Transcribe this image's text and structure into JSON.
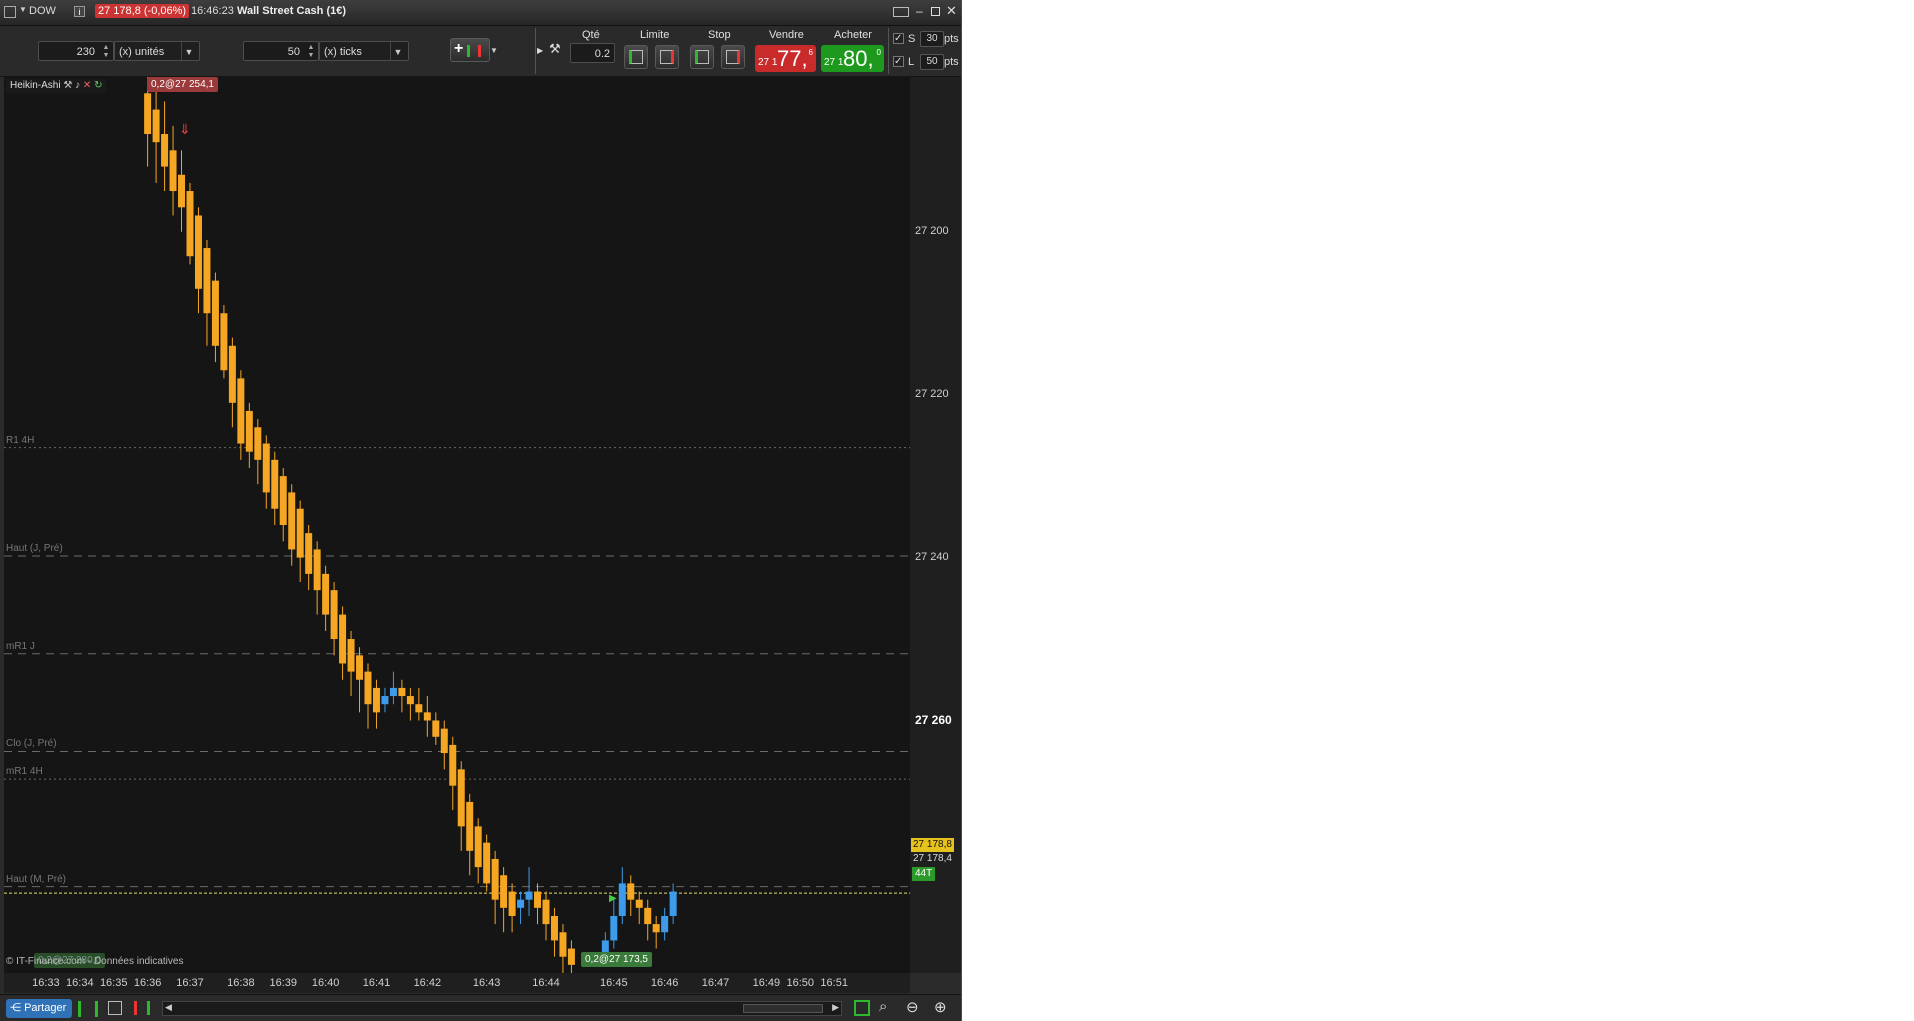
{
  "titlebar": {
    "symbol": "DOW",
    "price_change": "27 178,8 (-0,06%)",
    "time": "16:46:23",
    "instrument_name": "Wall Street Cash (1€)"
  },
  "toolbar": {
    "quantity_value": "230",
    "quantity_unit": "(x) unités",
    "ticks_value": "50",
    "ticks_unit": "(x) ticks",
    "qty_header": "Qté",
    "qty_value": "0.2",
    "limit_header": "Limite",
    "stop_header": "Stop",
    "sell_header": "Vendre",
    "buy_header": "Acheter",
    "sell_price_prefix": "27 1",
    "sell_price_big": "77,",
    "sell_price_sup": "6",
    "buy_price_prefix": "27 1",
    "buy_price_big": "80,",
    "buy_price_sup": "0",
    "stop_s_label": "S",
    "stop_s_value": "30",
    "stop_l_label": "L",
    "stop_l_value": "50",
    "pts": "pts"
  },
  "chart": {
    "indicator_name": "Heikin-Ashi",
    "order_top_tag": "0,2@27 254,1",
    "order_bottom_tag": "0,2@27 173,5",
    "order_left_tag": "0,2@27 280,0",
    "footer_note": "© IT-Finance.com - Données indicatives",
    "current_price": "27 178,8",
    "bid_price": "27 178,4",
    "tick_badge": "44T",
    "y_ticks": [
      "27 260",
      "27 240",
      "27 220",
      "27 200"
    ],
    "x_ticks": [
      "16:33",
      "16:34",
      "16:35",
      "16:36",
      "16:37",
      "16:38",
      "16:39",
      "16:40",
      "16:41",
      "16:42",
      "16:43",
      "16:44",
      "16:45",
      "16:46",
      "16:47",
      "16:49",
      "16:50",
      "16:51"
    ],
    "levels": [
      {
        "label": "R1 4H",
        "value": 27233.5,
        "style": "dotted"
      },
      {
        "label": "Haut (J, Pré)",
        "value": 27220.2,
        "style": "dashed"
      },
      {
        "label": "mR1 J",
        "value": 27208.2,
        "style": "dashed"
      },
      {
        "label": "Clo (J, Pré)",
        "value": 27196.2,
        "style": "dashed"
      },
      {
        "label": "mR1 4H",
        "value": 27192.8,
        "style": "dotted"
      },
      {
        "label": "Haut (M, Pré)",
        "value": 27179.6,
        "style": "dashed"
      }
    ],
    "colors": {
      "up": "#3d9be9",
      "down": "#f5a623",
      "level": "#6a6a6a",
      "price_line": "#e8e070"
    }
  },
  "bottombar": {
    "share_label": "Partager"
  },
  "chart_data": {
    "type": "candlestick",
    "title": "",
    "ylim": [
      27169,
      27279
    ],
    "y_ticks": [
      27200,
      27220,
      27240,
      27260
    ],
    "xlim": [
      0,
      105
    ],
    "x_tick_positions": [
      4,
      8,
      12,
      16,
      21,
      27,
      32,
      37,
      43,
      49,
      56,
      63,
      71,
      77,
      83,
      89,
      93,
      97
    ],
    "candles": [
      [
        16,
        27277.0,
        27272.0,
        27280.0,
        27268.0
      ],
      [
        17,
        27275.0,
        27271.0,
        27279.0,
        27266.0
      ],
      [
        18,
        27272.0,
        27268.0,
        27276.0,
        27265.0
      ],
      [
        19,
        27270.0,
        27265.0,
        27273.0,
        27262.0
      ],
      [
        20,
        27267.0,
        27263.0,
        27270.0,
        27260.0
      ],
      [
        21,
        27265.0,
        27257.0,
        27266.0,
        27256.0
      ],
      [
        22,
        27262.0,
        27253.0,
        27263.0,
        27250.0
      ],
      [
        23,
        27258.0,
        27250.0,
        27259.0,
        27246.0
      ],
      [
        24,
        27254.0,
        27246.0,
        27255.0,
        27244.0
      ],
      [
        25,
        27250.0,
        27243.0,
        27251.0,
        27242.0
      ],
      [
        26,
        27246.0,
        27239.0,
        27247.0,
        27236.0
      ],
      [
        27,
        27242.0,
        27234.0,
        27243.0,
        27232.0
      ],
      [
        28,
        27238.0,
        27233.0,
        27239.0,
        27231.0
      ],
      [
        29,
        27236.0,
        27232.0,
        27237.0,
        27229.0
      ],
      [
        30,
        27234.0,
        27228.0,
        27235.0,
        27226.0
      ],
      [
        31,
        27232.0,
        27226.0,
        27233.0,
        27224.0
      ],
      [
        32,
        27230.0,
        27224.0,
        27231.0,
        27222.0
      ],
      [
        33,
        27228.0,
        27221.0,
        27229.0,
        27219.0
      ],
      [
        34,
        27226.0,
        27220.0,
        27227.0,
        27217.0
      ],
      [
        35,
        27223.0,
        27218.0,
        27224.0,
        27216.0
      ],
      [
        36,
        27221.0,
        27216.0,
        27222.0,
        27213.0
      ],
      [
        37,
        27218.0,
        27213.0,
        27219.0,
        27211.0
      ],
      [
        38,
        27216.0,
        27210.0,
        27217.0,
        27208.0
      ],
      [
        39,
        27213.0,
        27207.0,
        27214.0,
        27205.0
      ],
      [
        40,
        27210.0,
        27206.0,
        27211.0,
        27203.0
      ],
      [
        41,
        27208.0,
        27205.0,
        27209.0,
        27201.0
      ],
      [
        42,
        27206.0,
        27202.0,
        27207.0,
        27199.0
      ],
      [
        43,
        27204.0,
        27201.0,
        27205.0,
        27199.0
      ],
      [
        44,
        27202.0,
        27203.0,
        27204.0,
        27201.0
      ],
      [
        45,
        27203.0,
        27204.0,
        27206.0,
        27202.0
      ],
      [
        46,
        27204.0,
        27203.0,
        27205.0,
        27201.0
      ],
      [
        47,
        27203.0,
        27202.0,
        27204.0,
        27200.0
      ],
      [
        48,
        27202.0,
        27201.0,
        27204.0,
        27200.0
      ],
      [
        49,
        27201.0,
        27200.0,
        27203.0,
        27198.0
      ],
      [
        50,
        27200.0,
        27198.0,
        27201.0,
        27197.0
      ],
      [
        51,
        27199.0,
        27196.0,
        27200.0,
        27194.0
      ],
      [
        52,
        27197.0,
        27192.0,
        27198.0,
        27189.0
      ],
      [
        53,
        27194.0,
        27187.0,
        27195.0,
        27184.0
      ],
      [
        54,
        27190.0,
        27184.0,
        27191.0,
        27181.0
      ],
      [
        55,
        27187.0,
        27182.0,
        27188.0,
        27180.0
      ],
      [
        56,
        27185.0,
        27180.0,
        27186.0,
        27179.0
      ],
      [
        57,
        27183.0,
        27178.0,
        27184.0,
        27175.0
      ],
      [
        58,
        27181.0,
        27177.0,
        27182.0,
        27174.0
      ],
      [
        59,
        27179.0,
        27176.0,
        27180.0,
        27174.0
      ],
      [
        60,
        27177.0,
        27178.0,
        27179.0,
        27175.0
      ],
      [
        61,
        27178.0,
        27179.0,
        27182.0,
        27176.0
      ],
      [
        62,
        27179.0,
        27177.0,
        27180.0,
        27175.0
      ],
      [
        63,
        27178.0,
        27175.0,
        27179.0,
        27173.0
      ],
      [
        64,
        27176.0,
        27173.0,
        27177.0,
        27171.0
      ],
      [
        65,
        27174.0,
        27171.0,
        27175.0,
        27169.0
      ],
      [
        66,
        27172.0,
        27170.0,
        27173.0,
        27169.0
      ],
      [
        70,
        27170.0,
        27173.0,
        27174.0,
        27170.0
      ],
      [
        71,
        27173.0,
        27176.0,
        27178.0,
        27172.0
      ],
      [
        72,
        27176.0,
        27180.0,
        27182.0,
        27175.0
      ],
      [
        73,
        27180.0,
        27178.0,
        27181.0,
        27176.0
      ],
      [
        74,
        27178.0,
        27177.0,
        27179.0,
        27175.0
      ],
      [
        75,
        27177.0,
        27175.0,
        27178.0,
        27173.0
      ],
      [
        76,
        27175.0,
        27174.0,
        27176.0,
        27172.0
      ],
      [
        77,
        27174.0,
        27176.0,
        27177.0,
        27173.0
      ],
      [
        78,
        27176.0,
        27179.0,
        27180.0,
        27175.0
      ]
    ]
  }
}
